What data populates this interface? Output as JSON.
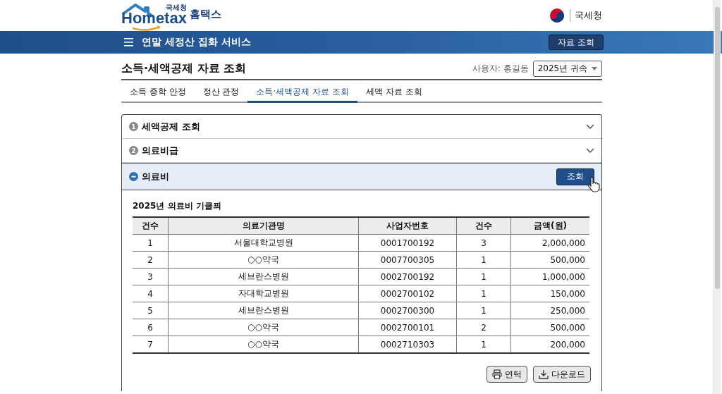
{
  "header": {
    "logo_small": "국세청",
    "logo_main": "Hometax",
    "logo_korean": "홈택스",
    "agency": "국세청"
  },
  "navbar": {
    "title": "연말 세정산 집화 서비스",
    "button": "자료 조회"
  },
  "page": {
    "title": "소득·세액공제 자료 조회",
    "user_label": "사용자: 홍길동",
    "year_select": "2025년 귀속"
  },
  "tabs": [
    {
      "label": "소득 증학 안정",
      "selected": false
    },
    {
      "label": "정산 관정",
      "selected": false
    },
    {
      "label": "소득·세액공제 자료 조회",
      "selected": true
    },
    {
      "label": "세액 자료 조회",
      "selected": false
    }
  ],
  "sections": [
    {
      "number": "1",
      "title": "세액공제 조회",
      "expanded": false
    },
    {
      "number": "2",
      "title": "의료비급",
      "expanded": false
    },
    {
      "title": "의료비",
      "expanded": true,
      "button": "조회",
      "subtitle": "2025년 의료비 기클픠",
      "table": {
        "columns": [
          "건수",
          "의료기관명",
          "사업자번호",
          "건수",
          "금액(원)"
        ],
        "rows": [
          [
            "1",
            "서울대학교병원",
            "0001700192",
            "3",
            "2,000,000"
          ],
          [
            "2",
            "○○약국",
            "0007700305",
            "1",
            "500,000"
          ],
          [
            "3",
            "세브란스병원",
            "0002700192",
            "1",
            "1,000,000"
          ],
          [
            "4",
            "자대학교병원",
            "0002700102",
            "1",
            "150,000"
          ],
          [
            "5",
            "세브란스병원",
            "0002700300",
            "1",
            "250,000"
          ],
          [
            "6",
            "○○약국",
            "0002700101",
            "2",
            "500,000"
          ],
          [
            "7",
            "○○약국",
            "0002710303",
            "1",
            "200,000"
          ]
        ]
      },
      "actions": [
        {
          "kind": "print",
          "label": "연턱"
        },
        {
          "kind": "download",
          "label": "다운로드"
        }
      ]
    }
  ]
}
